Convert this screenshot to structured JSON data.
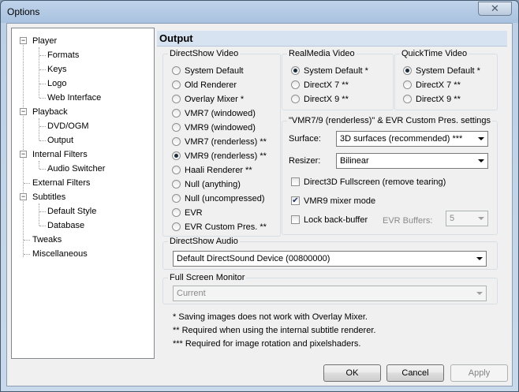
{
  "window": {
    "title": "Options",
    "close_glyph": "✕"
  },
  "tree": {
    "items": [
      {
        "label": "Player",
        "expander": "−"
      },
      {
        "label": "Formats"
      },
      {
        "label": "Keys"
      },
      {
        "label": "Logo"
      },
      {
        "label": "Web Interface"
      },
      {
        "label": "Playback",
        "expander": "−"
      },
      {
        "label": "DVD/OGM"
      },
      {
        "label": "Output"
      },
      {
        "label": "Internal Filters",
        "expander": "−"
      },
      {
        "label": "Audio Switcher"
      },
      {
        "label": "External Filters"
      },
      {
        "label": "Subtitles",
        "expander": "−"
      },
      {
        "label": "Default Style"
      },
      {
        "label": "Database"
      },
      {
        "label": "Tweaks"
      },
      {
        "label": "Miscellaneous"
      }
    ]
  },
  "page": {
    "header": "Output"
  },
  "directshow_video": {
    "label": "DirectShow Video",
    "options": [
      {
        "label": "System Default",
        "checked": false
      },
      {
        "label": "Old Renderer",
        "checked": false
      },
      {
        "label": "Overlay Mixer *",
        "checked": false
      },
      {
        "label": "VMR7 (windowed)",
        "checked": false
      },
      {
        "label": "VMR9 (windowed)",
        "checked": false
      },
      {
        "label": "VMR7 (renderless) **",
        "checked": false
      },
      {
        "label": "VMR9 (renderless) **",
        "checked": true
      },
      {
        "label": "Haali Renderer **",
        "checked": false
      },
      {
        "label": "Null (anything)",
        "checked": false
      },
      {
        "label": "Null (uncompressed)",
        "checked": false
      },
      {
        "label": "EVR",
        "checked": false
      },
      {
        "label": "EVR Custom Pres. **",
        "checked": false
      }
    ]
  },
  "realmedia_video": {
    "label": "RealMedia Video",
    "options": [
      {
        "label": "System Default *",
        "checked": true
      },
      {
        "label": "DirectX 7 **",
        "checked": false
      },
      {
        "label": "DirectX 9 **",
        "checked": false
      }
    ]
  },
  "quicktime_video": {
    "label": "QuickTime Video",
    "options": [
      {
        "label": "System Default *",
        "checked": true
      },
      {
        "label": "DirectX 7 **",
        "checked": false
      },
      {
        "label": "DirectX 9 **",
        "checked": false
      }
    ]
  },
  "vmr_settings": {
    "label": "\"VMR7/9 (renderless)\" & EVR Custom Pres. settings",
    "surface_label": "Surface:",
    "surface_value": "3D surfaces (recommended) ***",
    "resizer_label": "Resizer:",
    "resizer_value": "Bilinear",
    "d3d_fullscreen": {
      "label": "Direct3D Fullscreen (remove tearing)",
      "checked": false
    },
    "vmr9_mixer": {
      "label": "VMR9 mixer mode",
      "checked": true
    },
    "lock_backbuffer": {
      "label": "Lock back-buffer",
      "checked": false
    },
    "evr_buffers_label": "EVR Buffers:",
    "evr_buffers_value": "5"
  },
  "directshow_audio": {
    "label": "DirectShow Audio",
    "value": "Default DirectSound Device (00800000)"
  },
  "fullscreen_monitor": {
    "label": "Full Screen Monitor",
    "value": "Current"
  },
  "notes": [
    "* Saving images does not work with Overlay Mixer.",
    "** Required when using the internal subtitle renderer.",
    "*** Required for image rotation and pixelshaders."
  ],
  "buttons": {
    "ok": "OK",
    "cancel": "Cancel",
    "apply": "Apply"
  },
  "check_glyph": "✔"
}
